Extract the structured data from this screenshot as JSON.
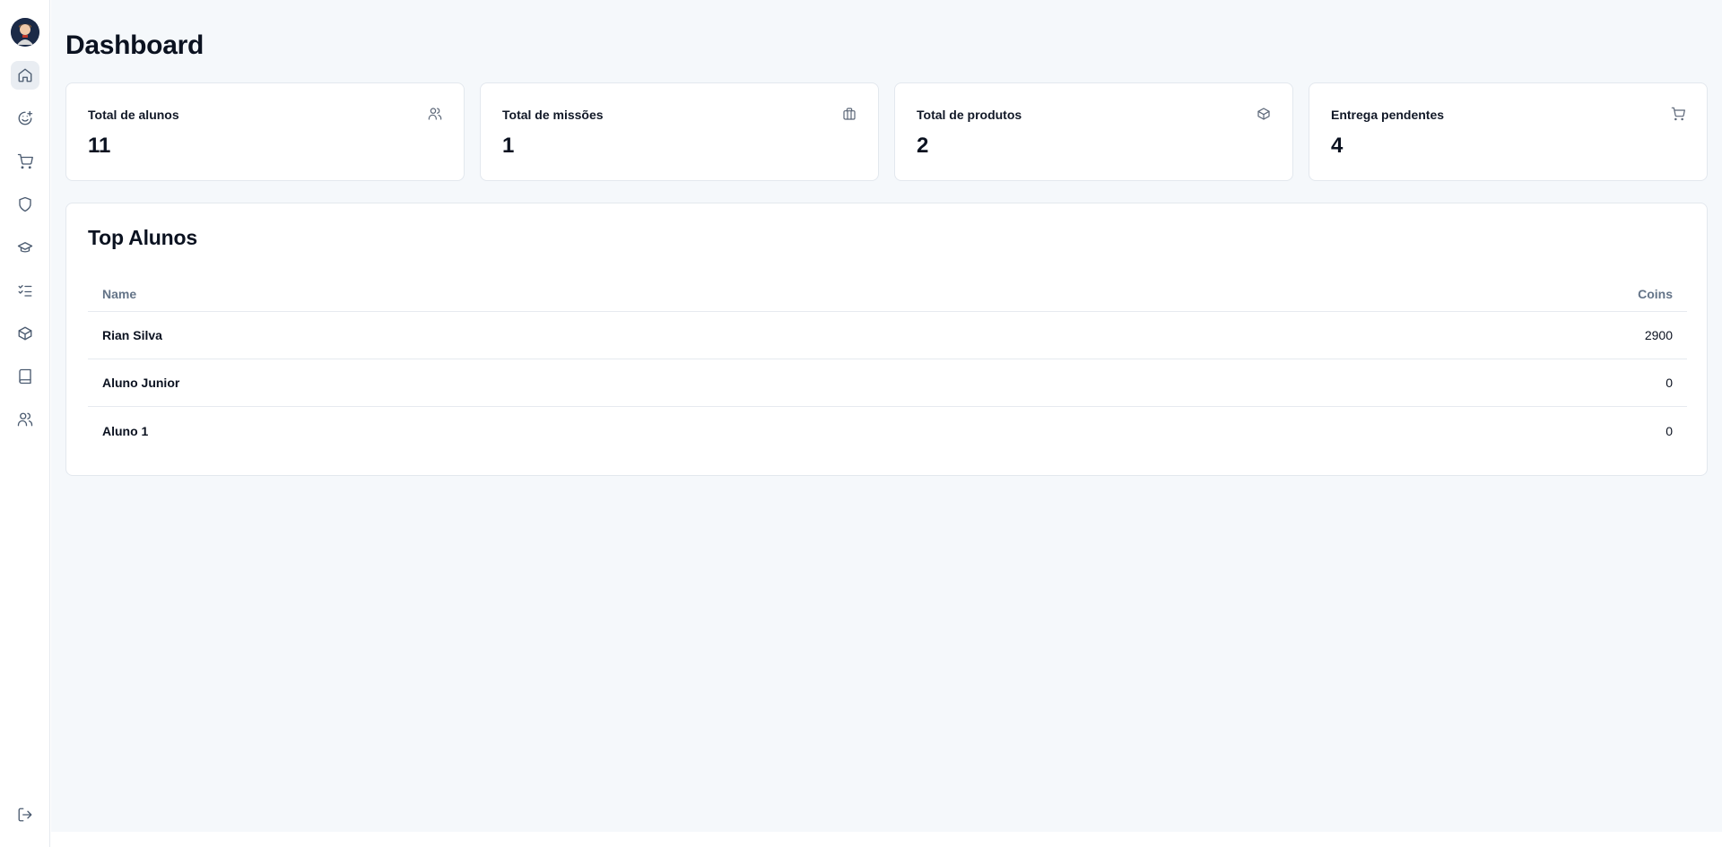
{
  "sidebar": {
    "items": [
      {
        "name": "home",
        "icon": "home-icon",
        "active": true
      },
      {
        "name": "missions",
        "icon": "smile-plus-icon"
      },
      {
        "name": "store",
        "icon": "cart-icon"
      },
      {
        "name": "security",
        "icon": "shield-icon"
      },
      {
        "name": "students",
        "icon": "graduation-cap-icon"
      },
      {
        "name": "tasks",
        "icon": "list-checks-icon"
      },
      {
        "name": "products",
        "icon": "package-icon"
      },
      {
        "name": "library",
        "icon": "book-icon"
      },
      {
        "name": "users",
        "icon": "users-icon"
      }
    ],
    "logout_icon": "logout-icon"
  },
  "page": {
    "title": "Dashboard"
  },
  "stats": [
    {
      "label": "Total de alunos",
      "value": "11",
      "icon": "users-icon"
    },
    {
      "label": "Total de missões",
      "value": "1",
      "icon": "briefcase-icon"
    },
    {
      "label": "Total de produtos",
      "value": "2",
      "icon": "package-icon"
    },
    {
      "label": "Entrega pendentes",
      "value": "4",
      "icon": "cart-icon"
    }
  ],
  "top_students": {
    "title": "Top Alunos",
    "columns": [
      "Name",
      "Coins"
    ],
    "rows": [
      {
        "name": "Rian Silva",
        "coins": "2900"
      },
      {
        "name": "Aluno Junior",
        "coins": "0"
      },
      {
        "name": "Aluno 1",
        "coins": "0"
      }
    ]
  },
  "colors": {
    "background": "#f5f8fb",
    "card": "#ffffff",
    "border": "#e3e8ee",
    "muted_text": "#647488",
    "active_nav": "#e9edf2"
  }
}
